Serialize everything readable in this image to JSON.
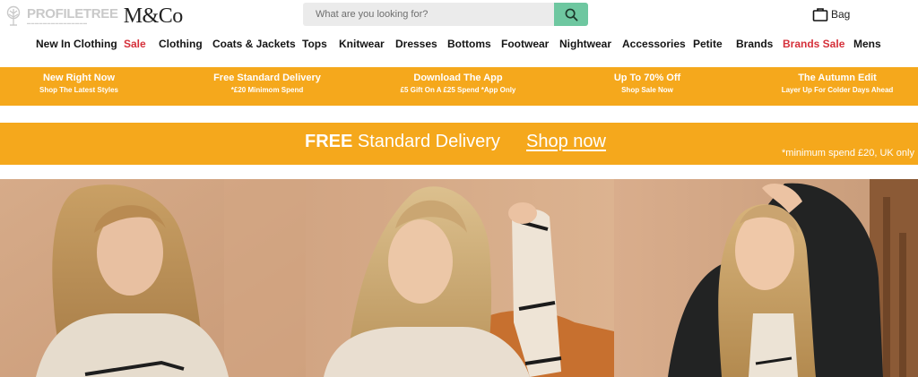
{
  "brand": {
    "profiletree": "PROFILETREE",
    "name": "M&Co"
  },
  "search": {
    "placeholder": "What are you looking for?"
  },
  "bag": {
    "label": "Bag"
  },
  "nav": [
    {
      "label": "New In Clothing",
      "sale": false
    },
    {
      "label": "Sale",
      "sale": true
    },
    {
      "label": "Clothing",
      "sale": false
    },
    {
      "label": "Coats & Jackets",
      "sale": false
    },
    {
      "label": "Tops",
      "sale": false
    },
    {
      "label": "Knitwear",
      "sale": false
    },
    {
      "label": "Dresses",
      "sale": false
    },
    {
      "label": "Bottoms",
      "sale": false
    },
    {
      "label": "Footwear",
      "sale": false
    },
    {
      "label": "Nightwear",
      "sale": false
    },
    {
      "label": "Accessories",
      "sale": false
    },
    {
      "label": "Petite",
      "sale": false
    },
    {
      "label": "Brands",
      "sale": false
    },
    {
      "label": "Brands Sale",
      "sale": true
    },
    {
      "label": "Mens",
      "sale": false
    }
  ],
  "promos": [
    {
      "title": "New Right Now",
      "sub": "Shop The Latest Styles"
    },
    {
      "title": "Free Standard Delivery",
      "sub": "*£20 Minimom Spend"
    },
    {
      "title": "Download The App",
      "sub": "£5 Gift On A £25 Spend *App Only"
    },
    {
      "title": "Up To 70% Off",
      "sub": "Shop Sale Now"
    },
    {
      "title": "The Autumn Edit",
      "sub": "Layer Up For Colder Days Ahead"
    }
  ],
  "delivery": {
    "free": "FREE",
    "text": "Standard Delivery",
    "cta": "Shop now",
    "note": "*minimum spend £20, UK only"
  },
  "colors": {
    "accent": "#f5a81c",
    "sale": "#d5303a",
    "search_button": "#6ec7a0"
  }
}
